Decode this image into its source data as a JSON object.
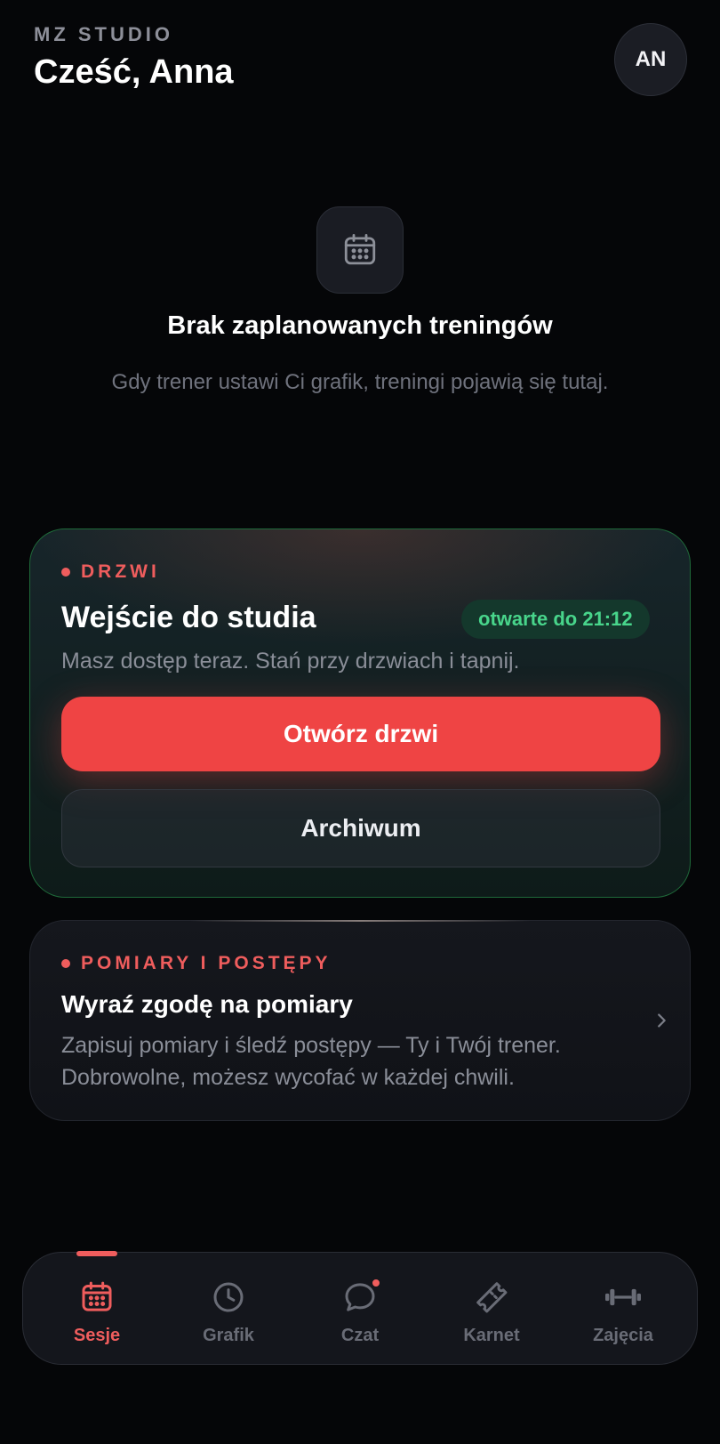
{
  "header": {
    "brand": "MZ STUDIO",
    "greeting": "Cześć, Anna",
    "avatar_initials": "AN"
  },
  "empty_state": {
    "icon": "calendar-icon",
    "title": "Brak zaplanowanych treningów",
    "description": "Gdy trener ustawi Ci grafik, treningi pojawią się tutaj."
  },
  "door_card": {
    "tag": "DRZWI",
    "title": "Wejście do studia",
    "status": "otwarte do 21:12",
    "description": "Masz dostęp teraz. Stań przy drzwiach i tapnij.",
    "open_button": "Otwórz drzwi",
    "archive_button": "Archiwum"
  },
  "measure_card": {
    "tag": "POMIARY I POSTĘPY",
    "title": "Wyraź zgodę na pomiary",
    "description": "Zapisuj pomiary i śledź postępy — Ty i Twój trener. Dobrowolne, możesz wycofać w każdej chwili.",
    "icon": "chevron-right-icon"
  },
  "bottom_nav": {
    "items": [
      {
        "label": "Sesje",
        "icon": "calendar-icon",
        "active": true
      },
      {
        "label": "Grafik",
        "icon": "clock-icon",
        "active": false
      },
      {
        "label": "Czat",
        "icon": "chat-bubble-icon",
        "active": false,
        "badge": true
      },
      {
        "label": "Karnet",
        "icon": "ticket-icon",
        "active": false
      },
      {
        "label": "Zajęcia",
        "icon": "dumbbell-icon",
        "active": false
      }
    ]
  },
  "colors": {
    "background": "#050608",
    "accent": "#ef4444",
    "accent_text": "#ef5d5d",
    "status_green": "#48d58b",
    "muted_text": "#8a8e98"
  }
}
